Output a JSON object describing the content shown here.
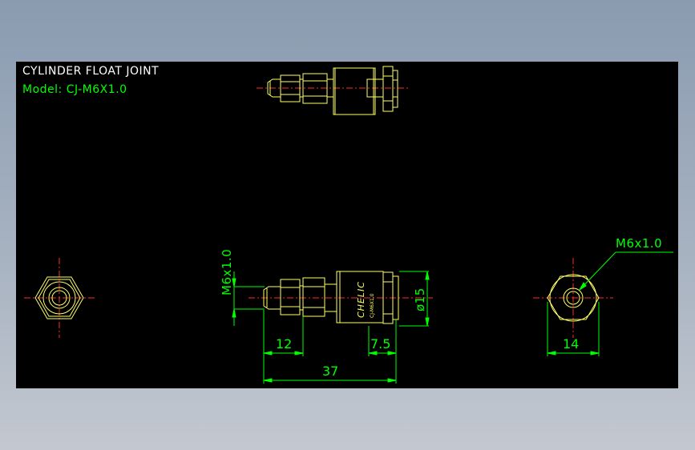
{
  "title": "CYLINDER FLOAT JOINT",
  "model": "Model: CJ-M6X1.0",
  "colors": {
    "background": "#000000",
    "part_outline": "#ffff66",
    "dimension": "#00ff00",
    "centerline": "#ff2a2a",
    "title_text": "#ffffff",
    "model_text": "#00ff00",
    "viewport_bg": "#8a9bb0"
  },
  "dimensions": {
    "thread_vertical": "M6x1.0",
    "nut_length": "12",
    "end_length": "7.5",
    "total_length": "37",
    "diameter": "ø15",
    "thread_leader": "M6x1.0",
    "hex_width": "14"
  },
  "body_label": "CHELIC",
  "body_sublabel": "CJ-M6X1.0"
}
